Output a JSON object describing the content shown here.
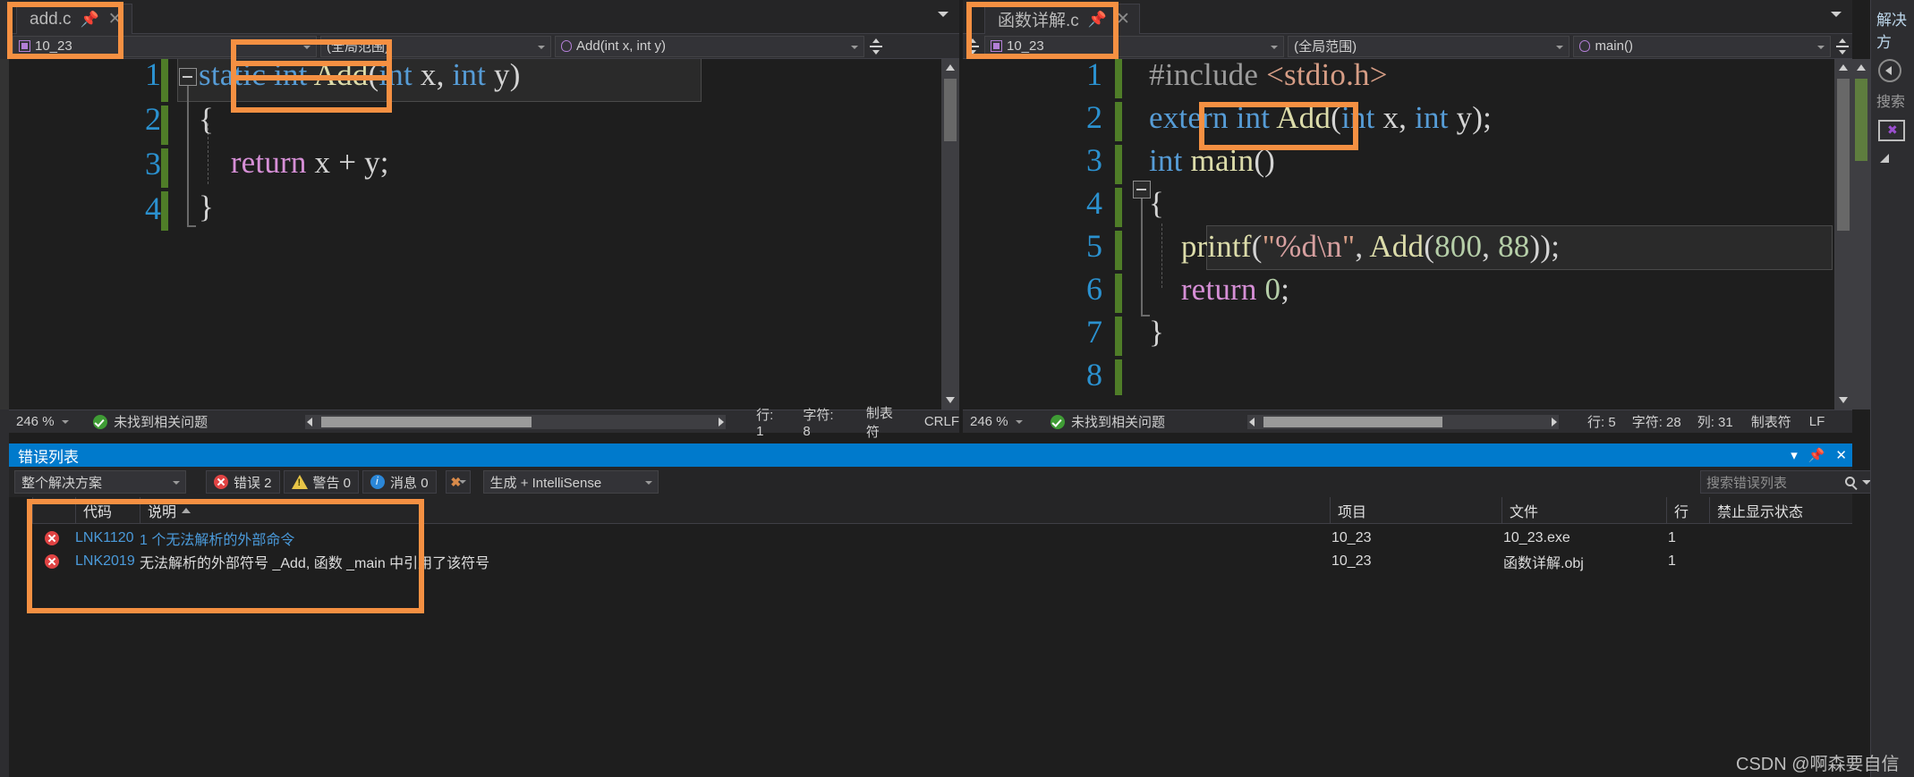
{
  "window": {
    "watermark": "CSDN @啊森要自信"
  },
  "left_pane": {
    "tab": {
      "label": "add.c",
      "pin_icon": "pin-icon",
      "close_icon": "close-icon"
    },
    "nav": {
      "project": "10_23",
      "scope": "(全局范围)",
      "member": "Add(int x, int y)",
      "project_icon": "project-icon",
      "member_icon": "method-icon"
    },
    "code": {
      "lines": [
        "1",
        "2",
        "3",
        "4"
      ],
      "text": [
        "static int Add(int x, int y)",
        "{",
        "    return x + y;",
        "}"
      ]
    },
    "status": {
      "zoom": "246 %",
      "issues": "未找到相关问题",
      "line": "行: 1",
      "char": "字符: 8",
      "tabs": "制表符",
      "eol": "CRLF"
    }
  },
  "right_pane": {
    "tab": {
      "label": "函数详解.c",
      "pin_icon": "pin-icon",
      "close_icon": "close-icon"
    },
    "nav": {
      "project": "10_23",
      "scope": "(全局范围)",
      "member": "main()",
      "project_icon": "project-icon",
      "member_icon": "method-icon"
    },
    "code": {
      "lines": [
        "1",
        "2",
        "3",
        "4",
        "5",
        "6",
        "7",
        "8"
      ],
      "text": [
        "#include <stdio.h>",
        "extern int Add(int x, int y);",
        "int main()",
        "{",
        "    printf(\"%d\\n\", Add(800, 88));",
        "    return 0;",
        "}",
        ""
      ]
    },
    "status": {
      "zoom": "246 %",
      "issues": "未找到相关问题",
      "line": "行: 5",
      "char": "字符: 28",
      "col": "列: 31",
      "tabs": "制表符",
      "eol": "LF"
    }
  },
  "error_panel": {
    "title": "错误列表",
    "toolbar": {
      "scope": "整个解决方案",
      "errors": "错误 2",
      "warnings": "警告 0",
      "messages": "消息 0",
      "filter_icon": "clear-filter-icon",
      "source": "生成 + IntelliSense"
    },
    "search_placeholder": "搜索错误列表",
    "search_icon": "search-icon",
    "columns": [
      "",
      "代码",
      "说明",
      "项目",
      "文件",
      "行",
      "禁止显示状态",
      ""
    ],
    "sorted_column": "说明",
    "rows": [
      {
        "icon": "error-icon",
        "code": "LNK1120",
        "description": "1 个无法解析的外部命令",
        "project": "10_23",
        "file": "10_23.exe",
        "line": "1",
        "suppression": ""
      },
      {
        "icon": "error-icon",
        "code": "LNK2019",
        "description": "无法解析的外部符号 _Add, 函数 _main 中引用了该符号",
        "project": "10_23",
        "file": "函数详解.obj",
        "line": "1",
        "suppression": ""
      }
    ]
  },
  "right_dock": {
    "title": "解决方",
    "search": "搜索",
    "back_icon": "back-arrow-icon",
    "vs-icon": "visual-studio-icon"
  },
  "annotations": {
    "count": 5,
    "color": "#f59042",
    "boxes": [
      "left-tab-highlight",
      "left-nav-combo-highlight",
      "static-keyword-highlight",
      "right-tab-highlight",
      "extern-keyword-highlight",
      "error-rows-highlight"
    ]
  }
}
